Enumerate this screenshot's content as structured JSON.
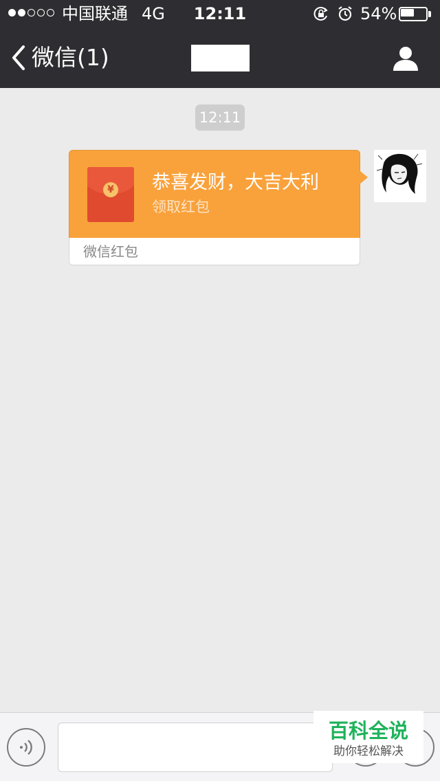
{
  "status_bar": {
    "signal_strength": 2,
    "signal_max": 5,
    "carrier": "中国联通",
    "network": "4G",
    "time": "12:11",
    "battery_percent_label": "54%",
    "battery_level": 0.54,
    "icons": [
      "orientation-lock-icon",
      "alarm-icon",
      "battery-icon"
    ]
  },
  "navbar": {
    "back_label": "微信(1)",
    "title": "",
    "icons": [
      "chevron-left-icon",
      "contact-profile-icon"
    ]
  },
  "chat": {
    "timestamp": "12:11",
    "messages": [
      {
        "type": "red_packet",
        "sender": "self",
        "greeting": "恭喜发财，大吉大利",
        "action": "领取红包",
        "footer": "微信红包",
        "coin_symbol": "¥"
      }
    ]
  },
  "input_bar": {
    "value": "",
    "icons": [
      "voice-icon",
      "emoji-icon",
      "plus-icon"
    ]
  },
  "watermark": {
    "brand": "百科全说",
    "slogan": "助你轻松解决"
  },
  "colors": {
    "bar_background": "#2e2e32",
    "chat_background": "#ebebeb",
    "red_packet_orange": "#f9a23c",
    "envelope_red": "#e04a2e",
    "watermark_green": "#1fb35b"
  }
}
